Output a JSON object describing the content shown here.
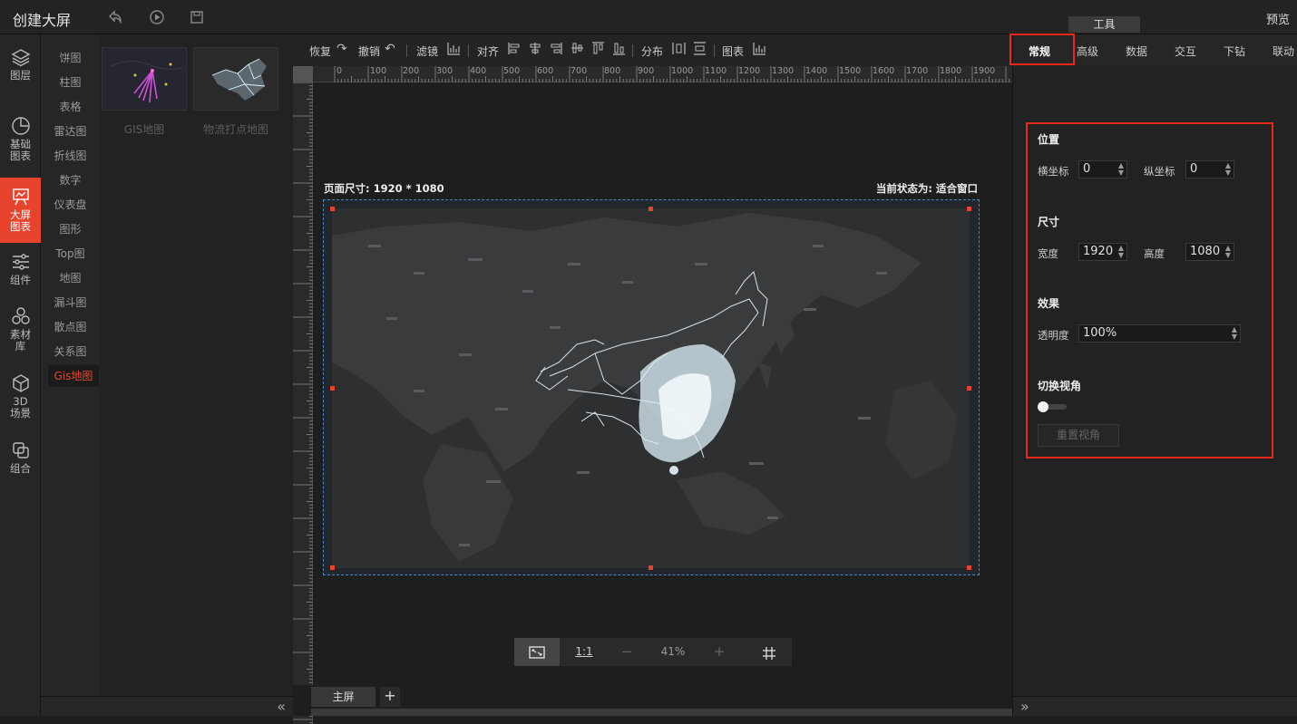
{
  "header": {
    "title": "创建大屏",
    "preview_label": "预览",
    "tools_tab": "工具",
    "icons": [
      "undo-icon",
      "play-icon",
      "save-icon"
    ]
  },
  "leftnav": {
    "items": [
      {
        "label": "图层",
        "icon": "layers-icon"
      },
      {
        "label": "基础图表",
        "icon": "pie-chart-icon"
      },
      {
        "label": "大屏图表",
        "icon": "presentation-chart-icon",
        "active": true
      },
      {
        "label": "组件",
        "icon": "sliders-icon"
      },
      {
        "label": "素材库",
        "icon": "material-icon"
      },
      {
        "label": "3D场景",
        "icon": "cube-icon"
      },
      {
        "label": "组合",
        "icon": "combine-icon"
      }
    ]
  },
  "categories": [
    "饼图",
    "柱图",
    "表格",
    "雷达图",
    "折线图",
    "数字",
    "仪表盘",
    "图形",
    "Top图",
    "地图",
    "漏斗图",
    "散点图",
    "关系图",
    "Gis地图"
  ],
  "active_category": "Gis地图",
  "thumbnails": [
    {
      "label": "GIS地图"
    },
    {
      "label": "物流打点地图"
    }
  ],
  "toolbar": {
    "redo": "恢复",
    "undo": "撤销",
    "filter": "滤镜",
    "align": "对齐",
    "distribute": "分布",
    "chart": "图表"
  },
  "ruler": {
    "h_ticks": [
      "0",
      "100",
      "200",
      "300",
      "400",
      "500",
      "600",
      "700",
      "800",
      "900",
      "1000",
      "1100",
      "1200",
      "1300",
      "1400",
      "1500",
      "1600",
      "1700",
      "1800",
      "1900"
    ],
    "v_ticks": [
      "100",
      "200",
      "300",
      "400",
      "500",
      "600",
      "700",
      "800",
      "900",
      "1000",
      "1100",
      "1200",
      "1300",
      "1400",
      "1500",
      "1600",
      "1700",
      "1800"
    ]
  },
  "canvas": {
    "page_size": "页面尺寸: 1920 * 1080",
    "status": "当前状态为: 适合窗口"
  },
  "zoom": {
    "fit_icon": "fit-screen-icon",
    "one_to_one": "1:1",
    "minus": "−",
    "level": "41%",
    "plus": "+",
    "grid_icon": "grid-icon"
  },
  "screens": {
    "main": "主屏",
    "add": "+"
  },
  "panel": {
    "tabs": [
      "常规",
      "高级",
      "数据",
      "交互",
      "下钻",
      "联动"
    ],
    "active_tab": "常规",
    "position_title": "位置",
    "x_label": "横坐标",
    "x_value": "0",
    "y_label": "纵坐标",
    "y_value": "0",
    "size_title": "尺寸",
    "width_label": "宽度",
    "width_value": "1920",
    "height_label": "高度",
    "height_value": "1080",
    "effect_title": "效果",
    "opacity_label": "透明度",
    "opacity_value": "100%",
    "view_title": "切换视角",
    "reset_view": "重置视角"
  },
  "colors": {
    "accent": "#e8432d",
    "highlight": "#e8291a"
  }
}
